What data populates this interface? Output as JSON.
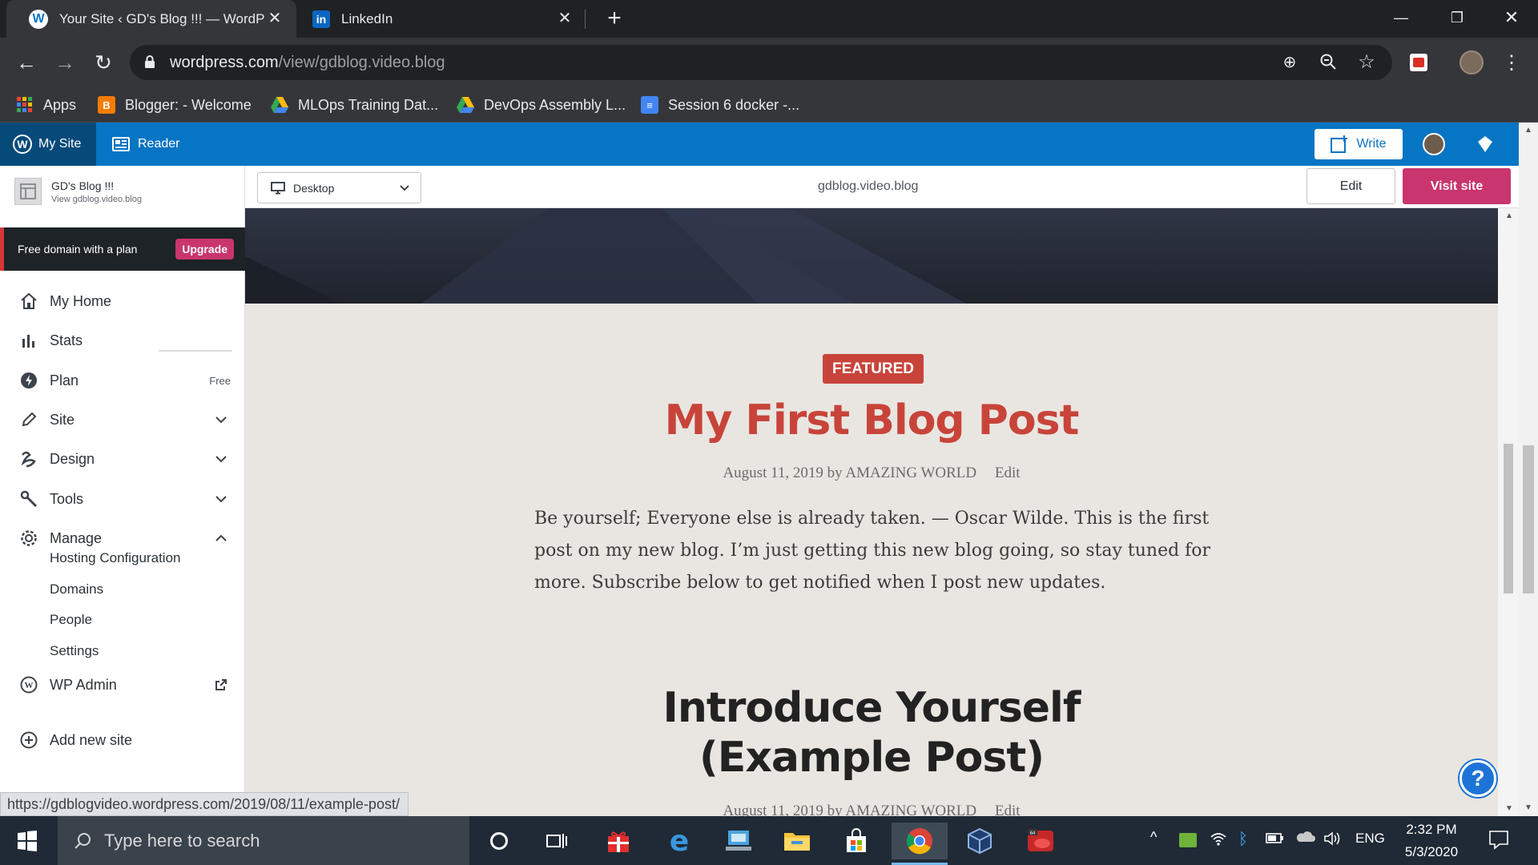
{
  "browser": {
    "tabs": [
      {
        "title": "Your Site ‹ GD's Blog !!! — WordP",
        "active": true
      },
      {
        "title": "LinkedIn",
        "active": false
      }
    ],
    "url_host": "wordpress.com",
    "url_path": "/view/gdblog.video.blog",
    "bookmarks": [
      "Apps",
      "Blogger: - Welcome",
      "MLOps Training Dat...",
      "DevOps Assembly L...",
      "Session 6 docker -..."
    ],
    "status_url": "https://gdblogvideo.wordpress.com/2019/08/11/example-post/"
  },
  "masterbar": {
    "my_site": "My Site",
    "reader": "Reader",
    "write": "Write"
  },
  "sidebar": {
    "site_name": "GD's Blog !!!",
    "site_url": "View gdblog.video.blog",
    "upsell": "Free domain with a plan",
    "upgrade": "Upgrade",
    "items": [
      {
        "label": "My Home",
        "icon": "home-icon"
      },
      {
        "label": "Stats",
        "icon": "stats-icon"
      },
      {
        "label": "Plan",
        "icon": "plan-icon",
        "badge": "Free"
      },
      {
        "label": "Site",
        "icon": "pencil-icon"
      },
      {
        "label": "Design",
        "icon": "design-icon"
      },
      {
        "label": "Tools",
        "icon": "tools-icon"
      },
      {
        "label": "Manage",
        "icon": "gear-icon"
      }
    ],
    "manage_sub": [
      "Hosting Configuration",
      "Domains",
      "People",
      "Settings"
    ],
    "wp_admin": "WP Admin",
    "add_site": "Add new site"
  },
  "preview_bar": {
    "device": "Desktop",
    "url": "gdblog.video.blog",
    "edit": "Edit",
    "visit": "Visit site"
  },
  "preview": {
    "featured": "FEATURED",
    "post1_title": "My First Blog Post",
    "post1_meta": "August 11, 2019 by AMAZING WORLD",
    "post1_edit": "Edit",
    "post1_excerpt": "Be yourself; Everyone else is already taken. — Oscar Wilde. This is the first post on my new blog. I’m just getting this new blog going, so stay tuned for more. Subscribe below to get notified when I post new updates.",
    "post2_title_line1": "Introduce Yourself",
    "post2_title_line2": "(Example Post)",
    "post2_meta": "August 11, 2019 by AMAZING WORLD",
    "post2_edit": "Edit"
  },
  "taskbar": {
    "search_placeholder": "Type here to search",
    "lang": "ENG",
    "time": "2:32 PM",
    "date": "5/3/2020"
  },
  "colors": {
    "wp_blue": "#0675c4",
    "visit_pink": "#c9356e",
    "featured_red": "#c8443a"
  }
}
